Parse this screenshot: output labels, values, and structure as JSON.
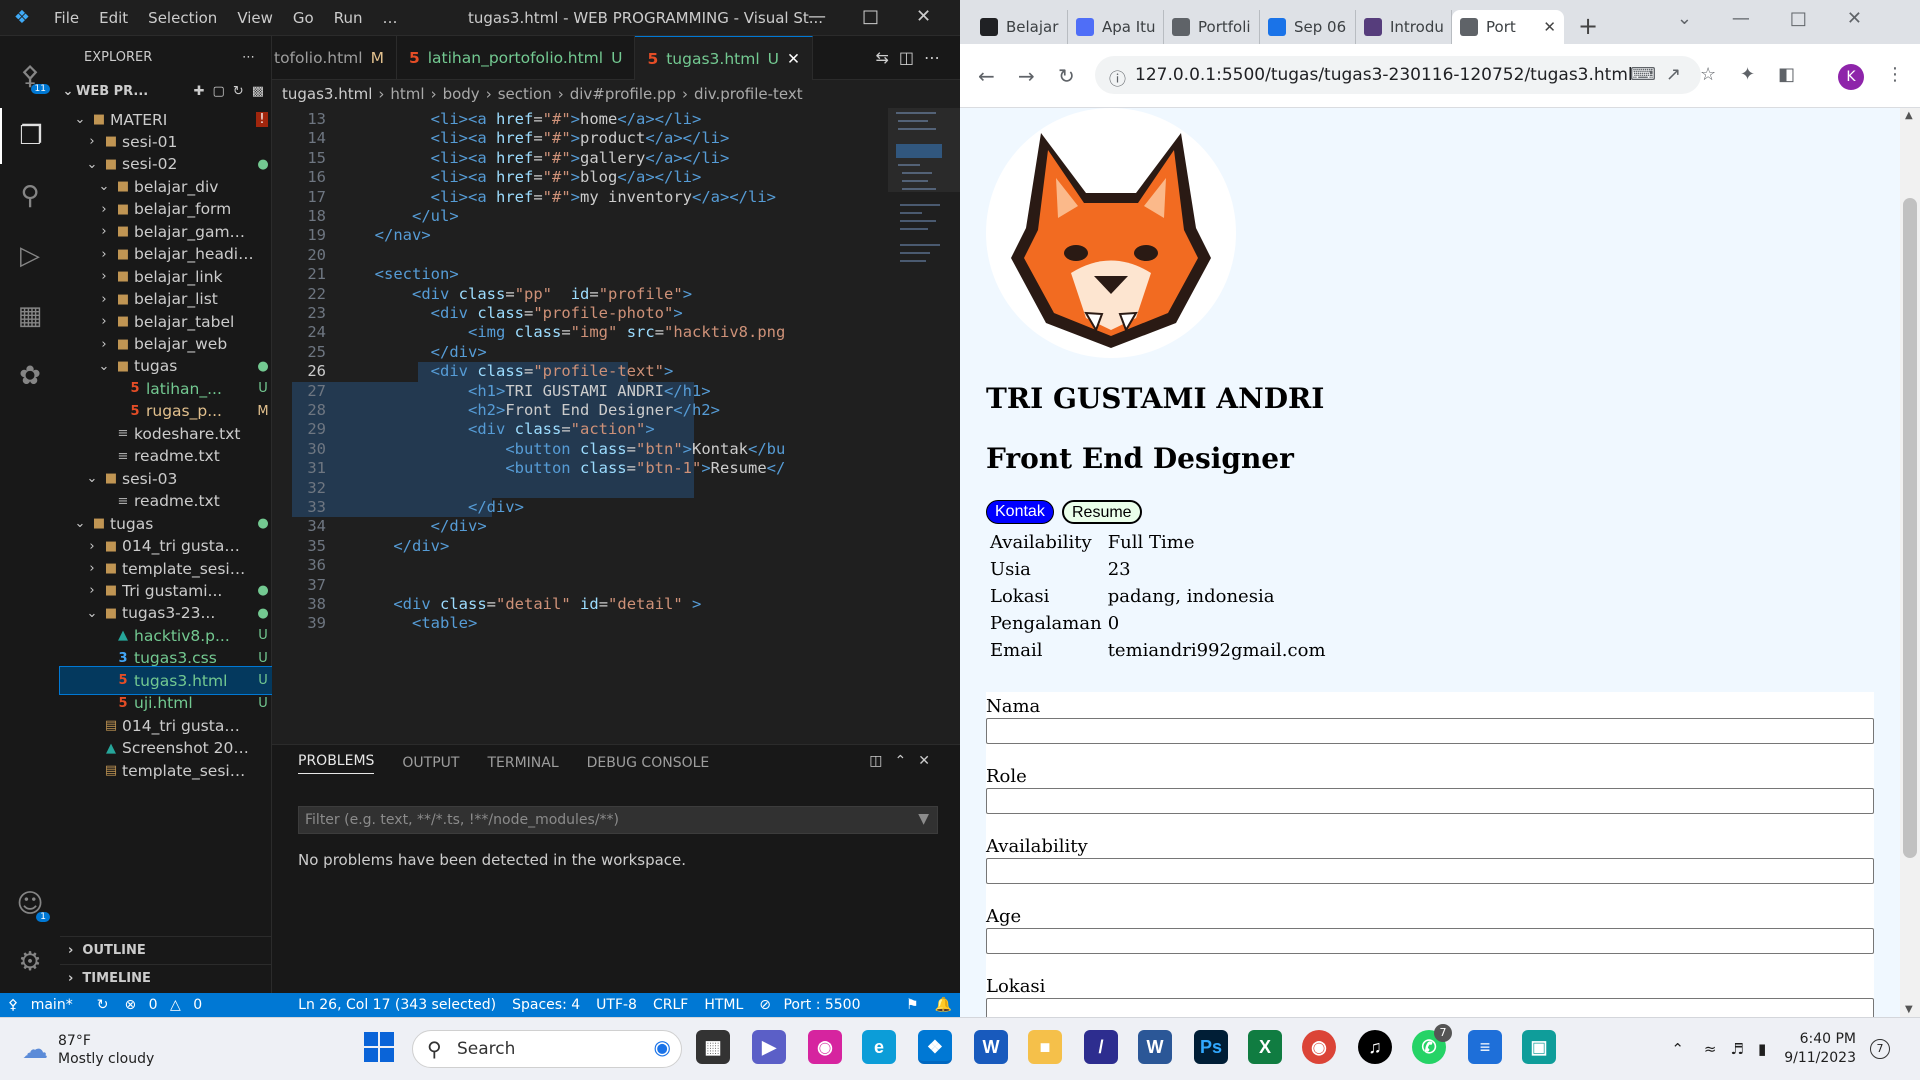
{
  "vscode": {
    "menu": [
      "File",
      "Edit",
      "Selection",
      "View",
      "Go",
      "Run",
      "…"
    ],
    "window_title": "tugas3.html - WEB PROGRAMMING - Visual St...",
    "activity_badges": {
      "source_control": "11",
      "accounts": "1"
    },
    "explorer": {
      "header": "EXPLORER",
      "workspace": "WEB PR...",
      "items": [
        {
          "depth": 1,
          "type": "folder",
          "open": true,
          "name": "MATERI",
          "status": "!"
        },
        {
          "depth": 2,
          "type": "folder",
          "open": false,
          "name": "sesi-01",
          "status": ""
        },
        {
          "depth": 2,
          "type": "folder",
          "open": true,
          "name": "sesi-02",
          "status": "●"
        },
        {
          "depth": 3,
          "type": "folder",
          "open": true,
          "name": "belajar_div",
          "status": ""
        },
        {
          "depth": 3,
          "type": "folder",
          "open": false,
          "name": "belajar_form",
          "status": ""
        },
        {
          "depth": 3,
          "type": "folder",
          "open": false,
          "name": "belajar_gambar",
          "status": ""
        },
        {
          "depth": 3,
          "type": "folder",
          "open": false,
          "name": "belajar_heading",
          "status": ""
        },
        {
          "depth": 3,
          "type": "folder",
          "open": false,
          "name": "belajar_link",
          "status": ""
        },
        {
          "depth": 3,
          "type": "folder",
          "open": false,
          "name": "belajar_list",
          "status": ""
        },
        {
          "depth": 3,
          "type": "folder",
          "open": false,
          "name": "belajar_tabel",
          "status": ""
        },
        {
          "depth": 3,
          "type": "folder",
          "open": false,
          "name": "belajar_web",
          "status": ""
        },
        {
          "depth": 3,
          "type": "folder",
          "open": true,
          "name": "tugas",
          "status": "●"
        },
        {
          "depth": 4,
          "type": "html",
          "name": "latihan_...",
          "status": "U"
        },
        {
          "depth": 4,
          "type": "html",
          "name": "rugas_p...",
          "status": "M"
        },
        {
          "depth": 3,
          "type": "txt",
          "name": "kodeshare.txt",
          "status": ""
        },
        {
          "depth": 3,
          "type": "txt",
          "name": "readme.txt",
          "status": ""
        },
        {
          "depth": 2,
          "type": "folder",
          "open": true,
          "name": "sesi-03",
          "status": ""
        },
        {
          "depth": 3,
          "type": "txt",
          "name": "readme.txt",
          "status": ""
        },
        {
          "depth": 1,
          "type": "folder",
          "open": true,
          "name": "tugas",
          "status": "●"
        },
        {
          "depth": 2,
          "type": "folder",
          "open": false,
          "name": "014_tri gustami ...",
          "status": ""
        },
        {
          "depth": 2,
          "type": "folder",
          "open": false,
          "name": "template_sesi02...",
          "status": ""
        },
        {
          "depth": 2,
          "type": "folder",
          "open": false,
          "name": "Tri gustami...",
          "status": "●"
        },
        {
          "depth": 2,
          "type": "folder",
          "open": true,
          "name": "tugas3-23...",
          "status": "●"
        },
        {
          "depth": 3,
          "type": "img",
          "name": "hacktiv8.p...",
          "status": "U"
        },
        {
          "depth": 3,
          "type": "css",
          "name": "tugas3.css",
          "status": "U"
        },
        {
          "depth": 3,
          "type": "html",
          "name": "tugas3.html",
          "status": "U",
          "selected": true
        },
        {
          "depth": 3,
          "type": "html",
          "name": "uji.html",
          "status": "U"
        },
        {
          "depth": 2,
          "type": "zip",
          "name": "014_tri gustami ...",
          "status": ""
        },
        {
          "depth": 2,
          "type": "img",
          "name": "Screenshot 2023...",
          "status": ""
        },
        {
          "depth": 2,
          "type": "zip",
          "name": "template_sesi02...",
          "status": ""
        }
      ],
      "outline": "OUTLINE",
      "timeline": "TIMELINE"
    },
    "tabs": [
      {
        "label": "tofolio.html",
        "status": "M",
        "active": false
      },
      {
        "label": "latihan_portofolio.html",
        "status": "U",
        "active": false
      },
      {
        "label": "tugas3.html",
        "status": "U",
        "active": true
      }
    ],
    "breadcrumb": [
      "tugas3.html",
      "html",
      "body",
      "section",
      "div#profile.pp",
      "div.profile-text"
    ],
    "code_lines": [
      {
        "n": "13",
        "html": "        <span class=t>&lt;li&gt;&lt;a</span> <span class=a>href</span>=<span class=s>\"#\"</span><span class=t>&gt;</span>home<span class=t>&lt;/a&gt;&lt;/li&gt;</span>"
      },
      {
        "n": "14",
        "html": "        <span class=t>&lt;li&gt;&lt;a</span> <span class=a>href</span>=<span class=s>\"#\"</span><span class=t>&gt;</span>product<span class=t>&lt;/a&gt;&lt;/li&gt;</span>"
      },
      {
        "n": "15",
        "html": "        <span class=t>&lt;li&gt;&lt;a</span> <span class=a>href</span>=<span class=s>\"#\"</span><span class=t>&gt;</span>gallery<span class=t>&lt;/a&gt;&lt;/li&gt;</span>"
      },
      {
        "n": "16",
        "html": "        <span class=t>&lt;li&gt;&lt;a</span> <span class=a>href</span>=<span class=s>\"#\"</span><span class=t>&gt;</span>blog<span class=t>&lt;/a&gt;&lt;/li&gt;</span>"
      },
      {
        "n": "17",
        "html": "        <span class=t>&lt;li&gt;&lt;a</span> <span class=a>href</span>=<span class=s>\"#\"</span><span class=t>&gt;</span>my inventory<span class=t>&lt;/a&gt;&lt;/li&gt;</span>"
      },
      {
        "n": "18",
        "html": "      <span class=t>&lt;/ul&gt;</span>"
      },
      {
        "n": "19",
        "html": "  <span class=t>&lt;/nav&gt;</span>"
      },
      {
        "n": "20",
        "html": ""
      },
      {
        "n": "21",
        "html": "  <span class=t>&lt;section&gt;</span>"
      },
      {
        "n": "22",
        "html": "      <span class=t>&lt;div</span> <span class=a>class</span>=<span class=s>\"pp\"</span>  <span class=a>id</span>=<span class=s>\"profile\"</span><span class=t>&gt;</span>"
      },
      {
        "n": "23",
        "html": "        <span class=t>&lt;div</span> <span class=a>class</span>=<span class=s>\"profile-photo\"</span><span class=t>&gt;</span>"
      },
      {
        "n": "24",
        "html": "            <span class=t>&lt;img</span> <span class=a>class</span>=<span class=s>\"img\"</span> <span class=a>src</span>=<span class=s>\"hacktiv8.png</span>"
      },
      {
        "n": "25",
        "html": "        <span class=t>&lt;/div&gt;</span>"
      },
      {
        "n": "26",
        "html": "        <span class=t>&lt;div</span> <span class=a>class</span>=<span class=s>\"profile-text\"</span><span class=t>&gt;</span>"
      },
      {
        "n": "27",
        "html": "            <span class=t>&lt;h1&gt;</span>TRI GUSTAMI ANDRI<span class=t>&lt;/h1&gt;</span>"
      },
      {
        "n": "28",
        "html": "            <span class=t>&lt;h2&gt;</span>Front End Designer<span class=t>&lt;/h2&gt;</span>"
      },
      {
        "n": "29",
        "html": "            <span class=t>&lt;div</span> <span class=a>class</span>=<span class=s>\"action\"</span><span class=t>&gt;</span>"
      },
      {
        "n": "30",
        "html": "                <span class=t>&lt;button</span> <span class=a>class</span>=<span class=s>\"btn\"</span><span class=t>&gt;</span>Kontak<span class=t>&lt;/bu</span>"
      },
      {
        "n": "31",
        "html": "                <span class=t>&lt;button</span> <span class=a>class</span>=<span class=s>\"btn-1\"</span><span class=t>&gt;</span>Resume<span class=t>&lt;/</span>"
      },
      {
        "n": "32",
        "html": ""
      },
      {
        "n": "33",
        "html": "            <span class=t>&lt;/div&gt;</span>"
      },
      {
        "n": "34",
        "html": "        <span class=t>&lt;/div&gt;</span>"
      },
      {
        "n": "35",
        "html": "    <span class=t>&lt;/div&gt;</span>"
      },
      {
        "n": "36",
        "html": ""
      },
      {
        "n": "37",
        "html": ""
      },
      {
        "n": "38",
        "html": "    <span class=t>&lt;div</span> <span class=a>class</span>=<span class=s>\"detail\"</span> <span class=a>id</span>=<span class=s>\"detail\"</span> <span class=t>&gt;</span>"
      },
      {
        "n": "39",
        "html": "      <span class=t>&lt;table&gt;</span>"
      }
    ],
    "current_line": "26",
    "panel": {
      "tabs": [
        "PROBLEMS",
        "OUTPUT",
        "TERMINAL",
        "DEBUG CONSOLE"
      ],
      "filter_placeholder": "Filter (e.g. text, **/*.ts, !**/node_modules/**)",
      "message": "No problems have been detected in the workspace."
    },
    "status": {
      "branch": "main*",
      "errors": "0",
      "warnings": "0",
      "position": "Ln 26, Col 17 (343 selected)",
      "spaces": "Spaces: 4",
      "encoding": "UTF-8",
      "eol": "CRLF",
      "language": "HTML",
      "port": "Port : 5500"
    }
  },
  "chrome": {
    "tabs": [
      {
        "label": "Belajar",
        "fav": "#202124"
      },
      {
        "label": "Apa Itu",
        "fav": "#4f6ef7"
      },
      {
        "label": "Portfoli",
        "fav": "#5f6368"
      },
      {
        "label": "Sep 06",
        "fav": "#1a73e8"
      },
      {
        "label": "Introdu",
        "fav": "#563d7c"
      },
      {
        "label": "Port",
        "fav": "#5f6368",
        "active": true
      }
    ],
    "url": "127.0.0.1:5500/tugas/tugas3-230116-120752/tugas3.html",
    "profile_initial": "K"
  },
  "page": {
    "name": "TRI GUSTAMI ANDRI",
    "role": "Front End Designer",
    "btn_contact": "Kontak",
    "btn_resume": "Resume",
    "info": [
      {
        "k": "Availability",
        "v": "Full Time"
      },
      {
        "k": "Usia",
        "v": "23"
      },
      {
        "k": "Lokasi",
        "v": "padang, indonesia"
      },
      {
        "k": "Pengalaman",
        "v": "0"
      },
      {
        "k": "Email",
        "v": "temiandri992gmail.com"
      }
    ],
    "form_labels": [
      "Nama",
      "Role",
      "Availability",
      "Age",
      "Lokasi"
    ]
  },
  "taskbar": {
    "temperature": "87°F",
    "weather": "Mostly cloudy",
    "search": "Search",
    "time": "6:40 PM",
    "date": "9/11/2023",
    "notif_count": "7",
    "whatsapp_badge": "7"
  }
}
